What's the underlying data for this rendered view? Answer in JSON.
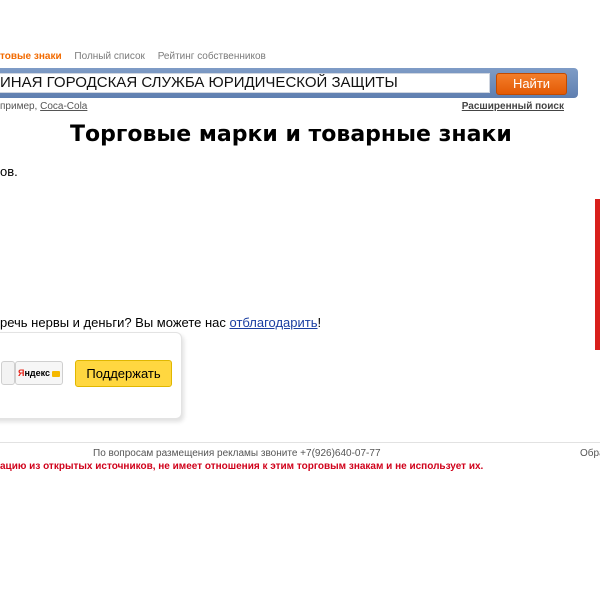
{
  "nav": {
    "active": "товые знаки",
    "full_list": "Полный список",
    "owners_rating": "Рейтинг собственников"
  },
  "search": {
    "value": "ИНАЯ ГОРОДСКАЯ СЛУЖБА ЮРИДИЧЕСКОЙ ЗАЩИТЫ",
    "button": "Найти",
    "example_prefix": "пример, ",
    "example_link": "Coca-Cola",
    "advanced": "Расширенный поиск"
  },
  "main": {
    "title": "Торговые марки и товарные знаки",
    "fragment": "ов.",
    "support_text_before": "речь нервы и деньги? Вы можете нас ",
    "support_link": "отблагодарить",
    "support_text_after": "!"
  },
  "donate": {
    "yandex_red": "Я",
    "yandex_rest": "ндекс",
    "support_button": "Поддержать"
  },
  "footer": {
    "ads": "По вопросам размещения рекламы звоните +7(926)640-07-77",
    "ads_right": "Обра",
    "disclaimer": "ацию из открытых источников, не имеет отношения к этим торговым знакам и не использует их."
  },
  "colors": {
    "accent_orange": "#f26a00",
    "search_bar": "#6f8dbd",
    "disclaimer_red": "#d0021b",
    "support_yellow": "#ffd740"
  }
}
